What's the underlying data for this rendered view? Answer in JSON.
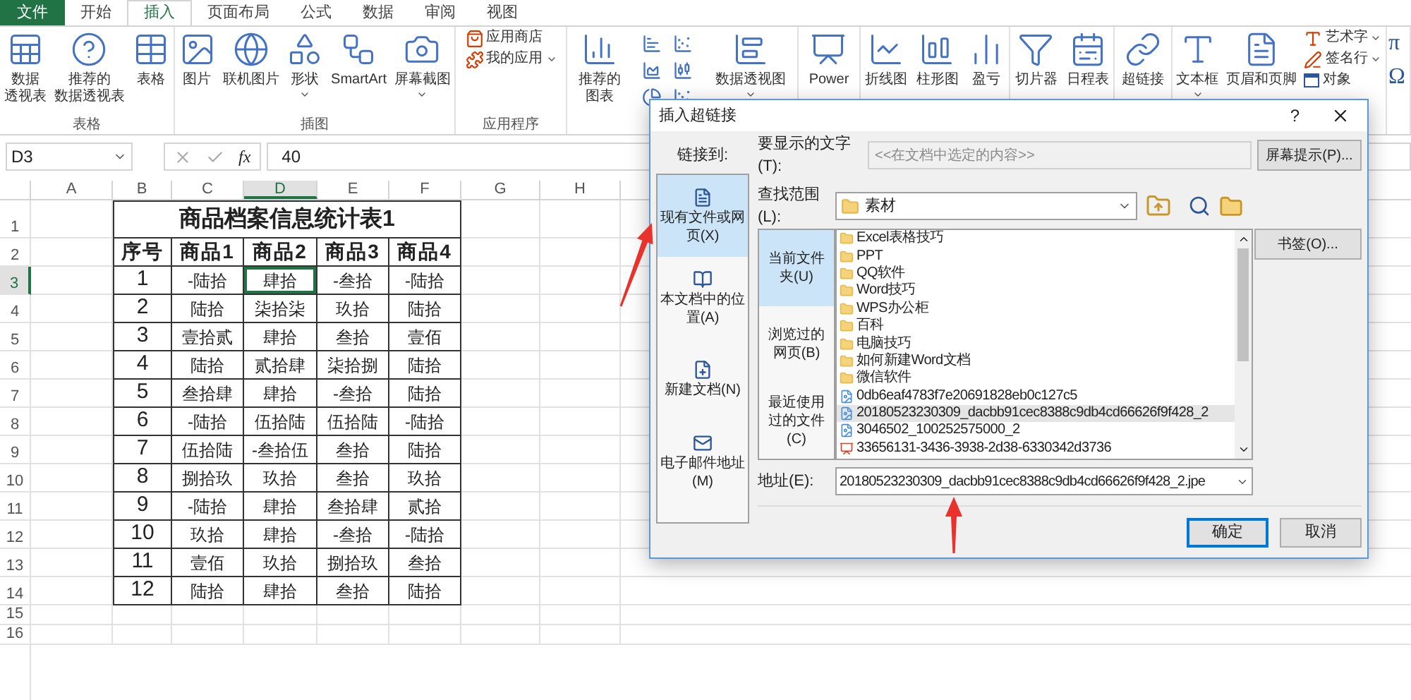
{
  "tabs": [
    {
      "label": "文件",
      "kind": "file",
      "selected": false
    },
    {
      "label": "开始",
      "kind": "tab",
      "selected": false
    },
    {
      "label": "插入",
      "kind": "tab",
      "selected": true
    },
    {
      "label": "页面布局",
      "kind": "tab",
      "selected": false
    },
    {
      "label": "公式",
      "kind": "tab",
      "selected": false
    },
    {
      "label": "数据",
      "kind": "tab",
      "selected": false
    },
    {
      "label": "审阅",
      "kind": "tab",
      "selected": false
    },
    {
      "label": "视图",
      "kind": "tab",
      "selected": false
    }
  ],
  "ribbon": [
    {
      "label": "表格",
      "items": [
        {
          "kind": "large",
          "lines": [
            "数据",
            "透视表"
          ],
          "dropdown": false
        },
        {
          "kind": "large",
          "lines": [
            "推荐的",
            "数据透视表"
          ],
          "dropdown": false
        },
        {
          "kind": "large",
          "lines": [
            "表格"
          ],
          "dropdown": false
        }
      ]
    },
    {
      "label": "插图",
      "items": [
        {
          "kind": "large",
          "lines": [
            "图片"
          ],
          "dropdown": false
        },
        {
          "kind": "large",
          "lines": [
            "联机图片"
          ],
          "dropdown": false
        },
        {
          "kind": "large",
          "lines": [
            "形状"
          ],
          "dropdown": true
        },
        {
          "kind": "large",
          "lines": [
            "SmartArt"
          ],
          "dropdown": false
        },
        {
          "kind": "large",
          "lines": [
            "屏幕截图"
          ],
          "dropdown": true
        }
      ]
    },
    {
      "label": "应用程序",
      "items": [
        {
          "kind": "stack",
          "items": [
            {
              "label": "应用商店",
              "dropdown": false
            },
            {
              "label": "我的应用",
              "dropdown": true
            }
          ]
        }
      ]
    },
    {
      "items": [
        {
          "kind": "large",
          "lines": [
            "推荐的",
            "图表"
          ],
          "dropdown": false
        },
        {
          "kind": "gallery"
        },
        {
          "kind": "large",
          "lines": [
            "数据透视图"
          ],
          "dropdown": true
        }
      ]
    },
    {
      "items": [
        {
          "kind": "large",
          "lines": [
            "Power"
          ],
          "dropdown": false
        }
      ]
    },
    {
      "items": [
        {
          "kind": "large",
          "lines": [
            "折线图"
          ],
          "dropdown": false
        },
        {
          "kind": "large",
          "lines": [
            "柱形图"
          ],
          "dropdown": false
        },
        {
          "kind": "large",
          "lines": [
            "盈亏"
          ],
          "dropdown": false
        }
      ]
    },
    {
      "items": [
        {
          "kind": "large",
          "lines": [
            "切片器"
          ],
          "dropdown": false
        },
        {
          "kind": "large",
          "lines": [
            "日程表"
          ],
          "dropdown": false
        }
      ]
    },
    {
      "items": [
        {
          "kind": "large",
          "lines": [
            "超链接"
          ],
          "dropdown": false
        }
      ]
    },
    {
      "items": [
        {
          "kind": "large",
          "lines": [
            "文本框"
          ],
          "dropdown": true
        },
        {
          "kind": "large",
          "lines": [
            "页眉和页脚"
          ],
          "dropdown": false
        },
        {
          "kind": "stack",
          "items": [
            {
              "label": "艺术字",
              "dropdown": true
            },
            {
              "label": "签名行",
              "dropdown": true
            },
            {
              "label": "对象",
              "dropdown": false
            }
          ]
        }
      ]
    },
    {
      "items": [
        {
          "kind": "symbol",
          "label": "π"
        },
        {
          "kind": "symbol",
          "label": "Ω"
        }
      ]
    }
  ],
  "sheet": {
    "name_box": "D3",
    "function_button": "fx",
    "formula": "40",
    "columns": [
      {
        "label": "A",
        "selected": false
      },
      {
        "label": "B",
        "selected": false
      },
      {
        "label": "C",
        "selected": false
      },
      {
        "label": "D",
        "selected": true
      },
      {
        "label": "E",
        "selected": false
      },
      {
        "label": "F",
        "selected": false
      },
      {
        "label": "G",
        "selected": false
      },
      {
        "label": "H",
        "selected": false
      }
    ],
    "row_headers": [
      {
        "label": "1",
        "selected": false
      },
      {
        "label": "2",
        "selected": false
      },
      {
        "label": "3",
        "selected": true
      },
      {
        "label": "4",
        "selected": false
      },
      {
        "label": "5",
        "selected": false
      },
      {
        "label": "6",
        "selected": false
      },
      {
        "label": "7",
        "selected": false
      },
      {
        "label": "8",
        "selected": false
      },
      {
        "label": "9",
        "selected": false
      },
      {
        "label": "10",
        "selected": false
      },
      {
        "label": "11",
        "selected": false
      },
      {
        "label": "12",
        "selected": false
      },
      {
        "label": "13",
        "selected": false
      },
      {
        "label": "14",
        "selected": false
      },
      {
        "label": "15",
        "selected": false
      },
      {
        "label": "16",
        "selected": false
      }
    ],
    "table": {
      "title": "商品档案信息统计表1",
      "headers": [
        "序号",
        "商品1",
        "商品2",
        "商品3",
        "商品4"
      ],
      "rows": [
        {
          "cells": [
            {
              "text": "1",
              "selected": false
            },
            {
              "text": "-陆拾",
              "selected": false
            },
            {
              "text": "肆拾",
              "selected": true
            },
            {
              "text": "-叁拾",
              "selected": false
            },
            {
              "text": "-陆拾",
              "selected": false
            }
          ]
        },
        {
          "cells": [
            {
              "text": "2",
              "selected": false
            },
            {
              "text": "陆拾",
              "selected": false
            },
            {
              "text": "柒拾柒",
              "selected": false
            },
            {
              "text": "玖拾",
              "selected": false
            },
            {
              "text": "陆拾",
              "selected": false
            }
          ]
        },
        {
          "cells": [
            {
              "text": "3",
              "selected": false
            },
            {
              "text": "壹拾贰",
              "selected": false
            },
            {
              "text": "肆拾",
              "selected": false
            },
            {
              "text": "叁拾",
              "selected": false
            },
            {
              "text": "壹佰",
              "selected": false
            }
          ]
        },
        {
          "cells": [
            {
              "text": "4",
              "selected": false
            },
            {
              "text": "陆拾",
              "selected": false
            },
            {
              "text": "贰拾肆",
              "selected": false
            },
            {
              "text": "柒拾捌",
              "selected": false
            },
            {
              "text": "陆拾",
              "selected": false
            }
          ]
        },
        {
          "cells": [
            {
              "text": "5",
              "selected": false
            },
            {
              "text": "叁拾肆",
              "selected": false
            },
            {
              "text": "肆拾",
              "selected": false
            },
            {
              "text": "-叁拾",
              "selected": false
            },
            {
              "text": "陆拾",
              "selected": false
            }
          ]
        },
        {
          "cells": [
            {
              "text": "6",
              "selected": false
            },
            {
              "text": "-陆拾",
              "selected": false
            },
            {
              "text": "伍拾陆",
              "selected": false
            },
            {
              "text": "伍拾陆",
              "selected": false
            },
            {
              "text": "-陆拾",
              "selected": false
            }
          ]
        },
        {
          "cells": [
            {
              "text": "7",
              "selected": false
            },
            {
              "text": "伍拾陆",
              "selected": false
            },
            {
              "text": "-叁拾伍",
              "selected": false
            },
            {
              "text": "叁拾",
              "selected": false
            },
            {
              "text": "陆拾",
              "selected": false
            }
          ]
        },
        {
          "cells": [
            {
              "text": "8",
              "selected": false
            },
            {
              "text": "捌拾玖",
              "selected": false
            },
            {
              "text": "玖拾",
              "selected": false
            },
            {
              "text": "叁拾",
              "selected": false
            },
            {
              "text": "玖拾",
              "selected": false
            }
          ]
        },
        {
          "cells": [
            {
              "text": "9",
              "selected": false
            },
            {
              "text": "-陆拾",
              "selected": false
            },
            {
              "text": "肆拾",
              "selected": false
            },
            {
              "text": "叁拾肆",
              "selected": false
            },
            {
              "text": "贰拾",
              "selected": false
            }
          ]
        },
        {
          "cells": [
            {
              "text": "10",
              "selected": false
            },
            {
              "text": "玖拾",
              "selected": false
            },
            {
              "text": "肆拾",
              "selected": false
            },
            {
              "text": "-叁拾",
              "selected": false
            },
            {
              "text": "-陆拾",
              "selected": false
            }
          ]
        },
        {
          "cells": [
            {
              "text": "11",
              "selected": false
            },
            {
              "text": "壹佰",
              "selected": false
            },
            {
              "text": "玖拾",
              "selected": false
            },
            {
              "text": "捌拾玖",
              "selected": false
            },
            {
              "text": "叁拾",
              "selected": false
            }
          ]
        },
        {
          "cells": [
            {
              "text": "12",
              "selected": false
            },
            {
              "text": "陆拾",
              "selected": false
            },
            {
              "text": "肆拾",
              "selected": false
            },
            {
              "text": "叁拾",
              "selected": false
            },
            {
              "text": "陆拾",
              "selected": false
            }
          ]
        }
      ]
    }
  },
  "dialog": {
    "title": "插入超链接",
    "help": "?",
    "link_to_label": "链接到:",
    "link_targets": [
      {
        "label": "现有文件或网页(X)",
        "selected": true
      },
      {
        "label": "本文档中的位置(A)",
        "selected": false
      },
      {
        "label": "新建文档(N)",
        "selected": false
      },
      {
        "label": "电子邮件地址(M)",
        "selected": false
      }
    ],
    "display_text": {
      "label": "要显示的文字(T):",
      "value": "<<在文档中选定的内容>>",
      "disabled": true
    },
    "screentip_button": "屏幕提示(P)...",
    "look_in": {
      "label": "查找范围(L):",
      "value": "素材"
    },
    "browse_tabs": [
      {
        "label": "当前文件夹(U)",
        "selected": true
      },
      {
        "label": "浏览过的网页(B)",
        "selected": false
      },
      {
        "label": "最近使用过的文件(C)",
        "selected": false
      }
    ],
    "files": [
      {
        "name": "Excel表格技巧",
        "kind": "folder",
        "selected": false
      },
      {
        "name": "PPT",
        "kind": "folder",
        "selected": false
      },
      {
        "name": "QQ软件",
        "kind": "folder",
        "selected": false
      },
      {
        "name": "Word技巧",
        "kind": "folder",
        "selected": false
      },
      {
        "name": "WPS办公柜",
        "kind": "folder",
        "selected": false
      },
      {
        "name": "百科",
        "kind": "folder",
        "selected": false
      },
      {
        "name": "电脑技巧",
        "kind": "folder",
        "selected": false
      },
      {
        "name": "如何新建Word文档",
        "kind": "folder",
        "selected": false
      },
      {
        "name": "微信软件",
        "kind": "folder",
        "selected": false
      },
      {
        "name": "0db6eaf4783f7e20691828eb0c127c5",
        "kind": "image",
        "selected": false
      },
      {
        "name": "20180523230309_dacbb91cec8388c9db4cd66626f9f428_2",
        "kind": "image",
        "selected": true
      },
      {
        "name": "3046502_100252575000_2",
        "kind": "image",
        "selected": false
      },
      {
        "name": "33656131-3436-3938-2d38-6330342d3736",
        "kind": "slides",
        "selected": false
      }
    ],
    "bookmark_button": "书签(O)...",
    "address": {
      "label": "地址(E):",
      "value": "20180523230309_dacbb91cec8388c9db4cd66626f9f428_2.jpe"
    },
    "buttons": [
      {
        "label": "确定",
        "default": true
      },
      {
        "label": "取消",
        "default": false
      }
    ]
  }
}
